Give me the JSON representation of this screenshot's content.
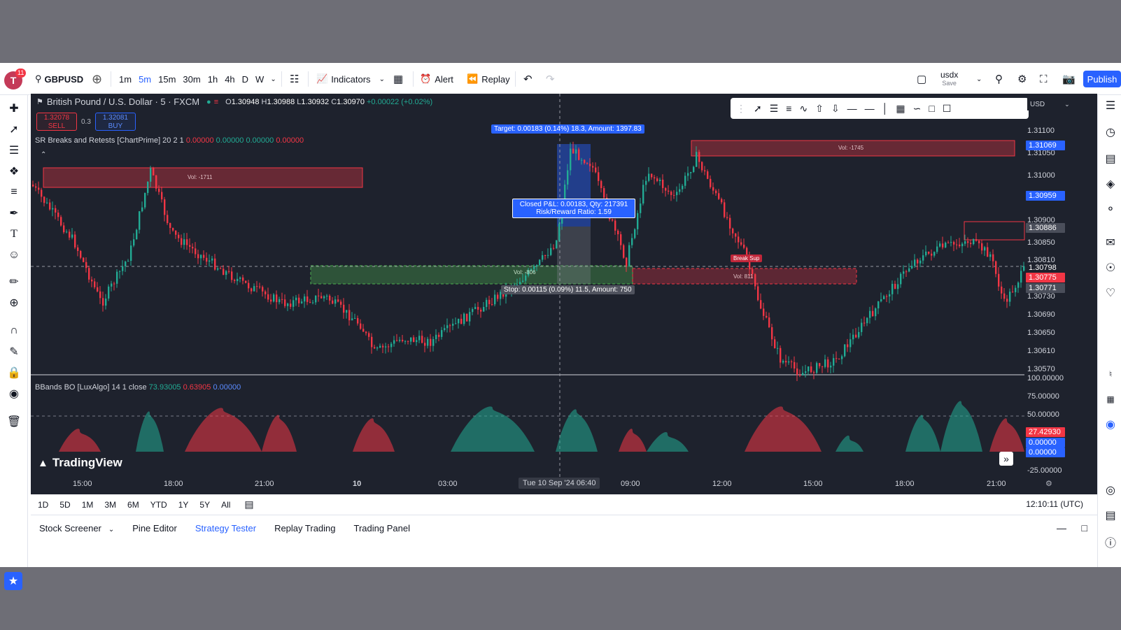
{
  "topbar": {
    "avatar_letter": "T",
    "notifications": "11",
    "symbol": "GBPUSD",
    "timeframes": [
      "1m",
      "5m",
      "15m",
      "30m",
      "1h",
      "4h",
      "D",
      "W"
    ],
    "active_timeframe": "5m",
    "indicators_label": "Indicators",
    "alert_label": "Alert",
    "replay_label": "Replay",
    "layout_name": "usdx",
    "layout_status": "Save",
    "publish_label": "Publish"
  },
  "chart": {
    "title": "British Pound / U.S. Dollar · 5 · FXCM",
    "ohlc": {
      "o": "1.30948",
      "h": "1.30988",
      "l": "1.30932",
      "c": "1.30970",
      "change": "+0.00022 (+0.02%)"
    },
    "sell_price": "1.32078",
    "sell_label": "SELL",
    "spread": "0.3",
    "buy_price": "1.32081",
    "buy_label": "BUY",
    "indicator1": {
      "name": "SR Breaks and Retests [ChartPrime] 20 2 1",
      "v1": "0.00000",
      "v2": "0.00000",
      "v3": "0.00000",
      "v4": "0.00000"
    },
    "indicator2": {
      "name": "BBands BO [LuxAlgo] 14 1 close",
      "v1": "73.93005",
      "v2": "0.63905",
      "v3": "0.00000"
    },
    "currency": "USD",
    "target_label": "Target: 0.00183 (0.14%) 18.3, Amount: 1397.83",
    "pnl_line1": "Closed P&L: 0.00183, Qty: 217391",
    "pnl_line2": "Risk/Reward Ratio: 1.59",
    "stop_label": "Stop: 0.00115 (0.09%) 11.5, Amount: 750",
    "vol_labels": [
      "Vol: -1711",
      "Vol: -1745",
      "Vol: -806",
      "Vol: 811"
    ],
    "break_label": "Break Sup",
    "price_axis": [
      "1.31100",
      "1.31050",
      "1.31000",
      "1.30900",
      "1.30850",
      "1.30810",
      "1.30730",
      "1.30690",
      "1.30650",
      "1.30610",
      "1.30570"
    ],
    "price_boxes": [
      {
        "value": "1.31069",
        "color": "#2962ff"
      },
      {
        "value": "1.30959",
        "color": "#2962ff"
      },
      {
        "value": "1.30886",
        "color": "#4a4e5a"
      },
      {
        "value": "1.30798",
        "color": "#1e222d"
      },
      {
        "value": "1.30775",
        "color": "#f23645"
      },
      {
        "value": "1.30771",
        "color": "#4a4e5a"
      }
    ],
    "osc_axis": [
      "100.00000",
      "75.00000",
      "50.00000",
      "-25.00000"
    ],
    "osc_boxes": [
      {
        "value": "27.42930",
        "color": "#f23645"
      },
      {
        "value": "0.00000",
        "color": "#2962ff"
      },
      {
        "value": "0.00000",
        "color": "#2962ff"
      }
    ],
    "time_axis": [
      "15:00",
      "18:00",
      "21:00",
      "10",
      "03:00",
      "09:00",
      "12:00",
      "15:00",
      "18:00",
      "21:00"
    ],
    "crosshair_time": "Tue 10 Sep '24  06:40",
    "brand": "TradingView"
  },
  "rangebar": {
    "ranges": [
      "1D",
      "5D",
      "1M",
      "3M",
      "6M",
      "YTD",
      "1Y",
      "5Y",
      "All"
    ],
    "clock": "12:10:11 (UTC)"
  },
  "panel_tabs": {
    "tabs": [
      "Stock Screener",
      "Pine Editor",
      "Strategy Tester",
      "Replay Trading",
      "Trading Panel"
    ],
    "active": "Strategy Tester"
  },
  "colors": {
    "up": "#22ab94",
    "down": "#f23645",
    "accent": "#2962ff",
    "chart_bg": "#1e222d"
  }
}
